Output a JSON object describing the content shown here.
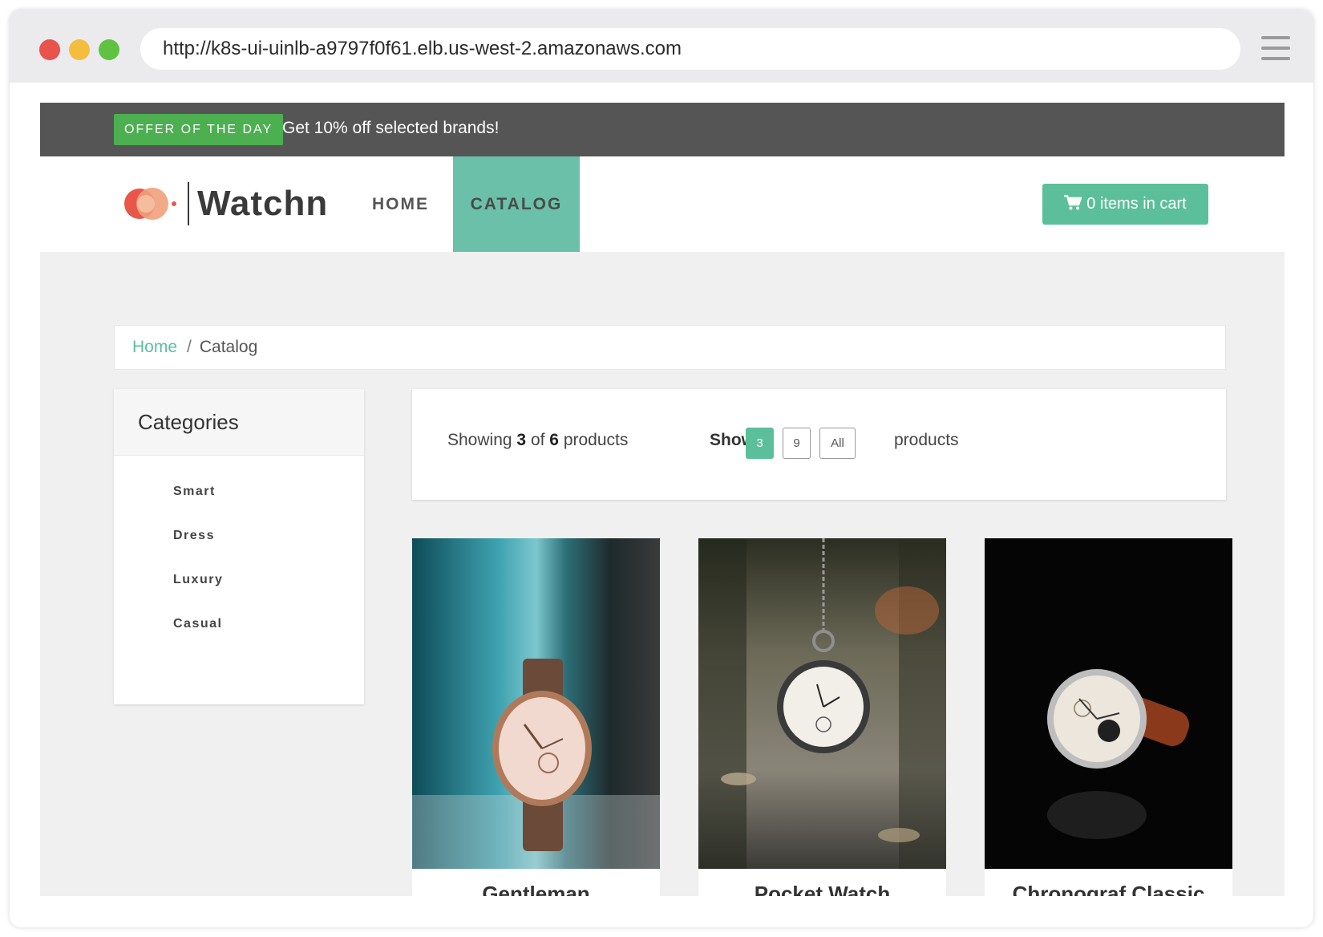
{
  "browser": {
    "url": "http://k8s-ui-uinlb-a9797f0f61.elb.us-west-2.amazonaws.com"
  },
  "offer": {
    "badge": "OFFER OF THE DAY",
    "text": "Get 10% off selected brands!"
  },
  "nav": {
    "brand": "Watchn",
    "items": [
      {
        "label": "HOME",
        "active": false
      },
      {
        "label": "CATALOG",
        "active": true
      }
    ],
    "cart_label": "0 items in cart"
  },
  "breadcrumb": {
    "home": "Home",
    "separator": "/",
    "current": "Catalog"
  },
  "categories": {
    "title": "Categories",
    "items": [
      "Smart",
      "Dress",
      "Luxury",
      "Casual"
    ]
  },
  "toolbar": {
    "showing_prefix": "Showing",
    "shown": "3",
    "of": "of",
    "total": "6",
    "products_word": "products",
    "show_label": "Show",
    "page_sizes": [
      "3",
      "9",
      "All"
    ],
    "active_page_size": "3",
    "products_label": "products"
  },
  "products": [
    {
      "name": "Gentleman"
    },
    {
      "name": "Pocket Watch"
    },
    {
      "name": "Chronograf Classic"
    }
  ],
  "colors": {
    "accent": "#5cbf9b",
    "offer_green": "#4caf50",
    "offer_bar": "#555555"
  }
}
